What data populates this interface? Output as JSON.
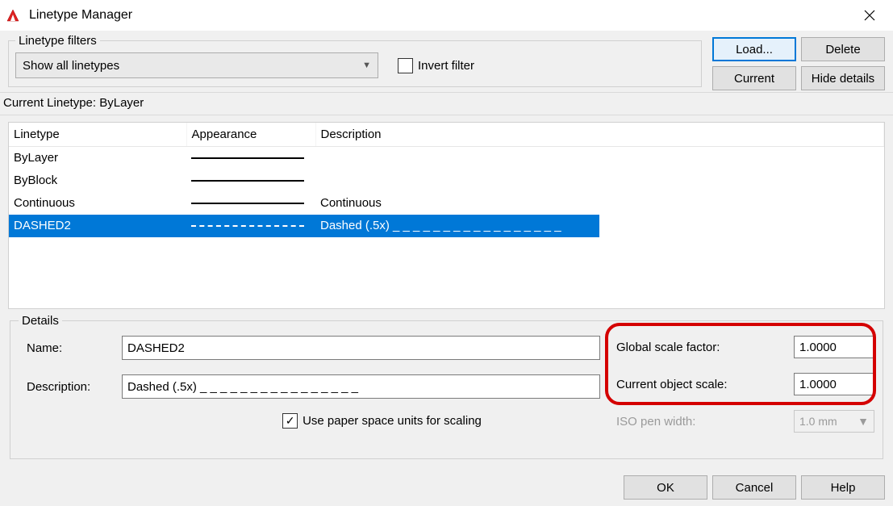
{
  "titlebar": {
    "title": "Linetype Manager"
  },
  "filters": {
    "legend": "Linetype filters",
    "combo_value": "Show all linetypes",
    "invert_label": "Invert filter",
    "invert_checked": false
  },
  "buttons": {
    "load": "Load...",
    "delete": "Delete",
    "current": "Current",
    "hide_details": "Hide details"
  },
  "current_linetype_label": "Current Linetype:  ByLayer",
  "columns": {
    "linetype": "Linetype",
    "appearance": "Appearance",
    "description": "Description"
  },
  "rows": [
    {
      "name": "ByLayer",
      "appearance": "solid",
      "description": "",
      "selected": false
    },
    {
      "name": "ByBlock",
      "appearance": "solid",
      "description": "",
      "selected": false
    },
    {
      "name": "Continuous",
      "appearance": "solid",
      "description": "Continuous",
      "selected": false
    },
    {
      "name": "DASHED2",
      "appearance": "dashed",
      "description": "Dashed (.5x) _ _ _ _ _ _ _ _ _ _ _ _ _ _ _ _ _",
      "selected": true
    }
  ],
  "details": {
    "legend": "Details",
    "name_label": "Name:",
    "name_value": "DASHED2",
    "desc_label": "Description:",
    "desc_value": "Dashed (.5x) _ _ _ _ _ _ _ _ _ _ _ _ _ _ _ _",
    "paperspace_label": "Use paper space units for scaling",
    "paperspace_checked": true,
    "global_label": "Global scale factor:",
    "global_value": "1.0000",
    "object_label": "Current object scale:",
    "object_value": "1.0000",
    "iso_label": "ISO pen width:",
    "iso_value": "1.0 mm"
  },
  "footer": {
    "ok": "OK",
    "cancel": "Cancel",
    "help": "Help"
  }
}
